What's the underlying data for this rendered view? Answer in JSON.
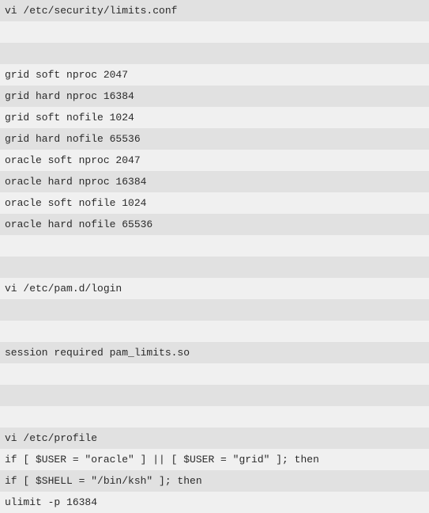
{
  "lines": [
    {
      "text": "vi /etc/security/limits.conf",
      "cls": "shade"
    },
    {
      "text": "",
      "cls": "light"
    },
    {
      "text": "",
      "cls": "shade"
    },
    {
      "text": "grid soft nproc 2047",
      "cls": "light"
    },
    {
      "text": "grid hard nproc 16384",
      "cls": "shade"
    },
    {
      "text": "grid soft nofile 1024",
      "cls": "light"
    },
    {
      "text": "grid hard nofile 65536",
      "cls": "shade"
    },
    {
      "text": "oracle soft nproc 2047",
      "cls": "light"
    },
    {
      "text": "oracle hard nproc 16384",
      "cls": "shade"
    },
    {
      "text": "oracle soft nofile 1024",
      "cls": "light"
    },
    {
      "text": "oracle hard nofile 65536",
      "cls": "shade"
    },
    {
      "text": "",
      "cls": "light"
    },
    {
      "text": "",
      "cls": "shade"
    },
    {
      "text": "vi /etc/pam.d/login",
      "cls": "light"
    },
    {
      "text": "",
      "cls": "shade"
    },
    {
      "text": "",
      "cls": "light"
    },
    {
      "text": "session required pam_limits.so",
      "cls": "shade"
    },
    {
      "text": "",
      "cls": "light"
    },
    {
      "text": "",
      "cls": "shade"
    },
    {
      "text": "",
      "cls": "light"
    },
    {
      "text": "vi /etc/profile",
      "cls": "shade"
    },
    {
      "text": "if [ $USER = \"oracle\" ] || [ $USER = \"grid\" ]; then",
      "cls": "light"
    },
    {
      "text": "if [ $SHELL = \"/bin/ksh\" ]; then",
      "cls": "shade"
    },
    {
      "text": "ulimit -p 16384",
      "cls": "light"
    }
  ]
}
